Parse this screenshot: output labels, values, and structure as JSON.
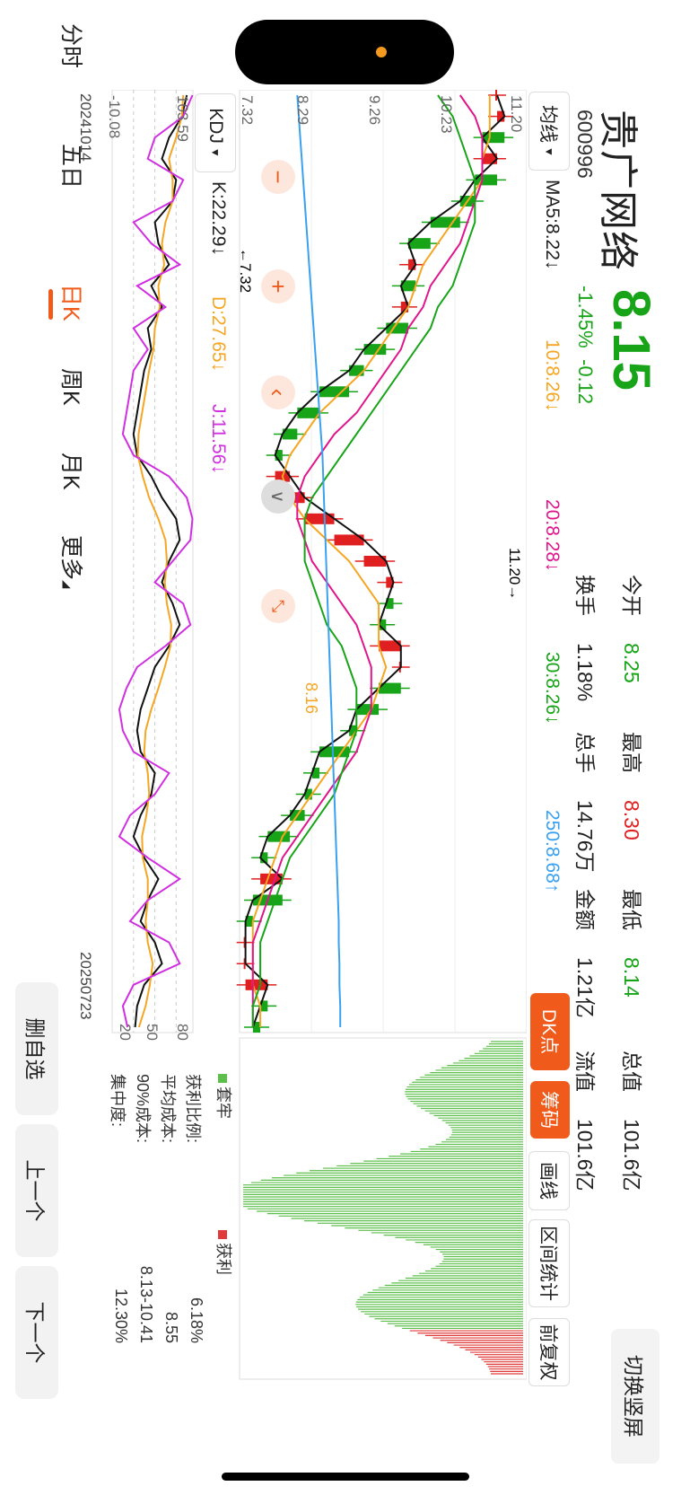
{
  "header": {
    "name": "贵广网络",
    "code": "600996",
    "price": "8.15",
    "change_pct": "-1.45%",
    "change_abs": "-0.12",
    "switch_label": "切换竖屏"
  },
  "stats": [
    {
      "label": "今开",
      "value": "8.25",
      "color": "green"
    },
    {
      "label": "最高",
      "value": "8.30",
      "color": "red"
    },
    {
      "label": "最低",
      "value": "8.14",
      "color": "green"
    },
    {
      "label": "总值",
      "value": "101.6亿",
      "color": "plain"
    },
    {
      "label": "换手",
      "value": "1.18%",
      "color": "plain"
    },
    {
      "label": "总手",
      "value": "14.76万",
      "color": "plain"
    },
    {
      "label": "金额",
      "value": "1.21亿",
      "color": "plain"
    },
    {
      "label": "流值",
      "value": "101.6亿",
      "color": "plain"
    }
  ],
  "toolbar": {
    "ma_button": "均线",
    "ma_values": [
      {
        "text": "MA5:8.22↓",
        "color": "#222222"
      },
      {
        "text": "10:8.26↓",
        "color": "#f5a623"
      },
      {
        "text": "20:8.28↓",
        "color": "#e0158c"
      },
      {
        "text": "30:8.26↓",
        "color": "#18a418"
      },
      {
        "text": "250:8.68↑",
        "color": "#3aa0f0"
      }
    ],
    "dk_button": "DK点",
    "chips_button": "筹码",
    "draw_button": "画线",
    "range_button": "区间统计",
    "adjust_button": "前复权"
  },
  "price_axis": {
    "labels": [
      "11.20",
      "10.23",
      "9.26",
      "8.29",
      "7.32"
    ]
  },
  "annotations": {
    "high_mark": "11.20",
    "low_mark": "7.32",
    "mid_mark": "8.16"
  },
  "kdj": {
    "button": "KDJ",
    "values": [
      {
        "text": "K:22.29↓",
        "color": "#222222"
      },
      {
        "text": "D:27.65↓",
        "color": "#f5a623"
      },
      {
        "text": "J:11.56↓",
        "color": "#d030e0"
      }
    ],
    "axis_top": "103.59",
    "axis_bottom": "-10.08",
    "ref_80": "80",
    "ref_50": "50",
    "ref_20": "20"
  },
  "dates": {
    "start": "20241014",
    "end": "20250723"
  },
  "chips": {
    "legend_trapped": "套牢",
    "legend_profit": "获利",
    "rows": [
      {
        "label": "获利比例:",
        "value": "6.18%"
      },
      {
        "label": "平均成本:",
        "value": "8.55"
      },
      {
        "label": "90%成本:",
        "value": "8.13-10.41"
      },
      {
        "label": "集中度:",
        "value": "12.30%"
      }
    ]
  },
  "tabs": [
    "分时",
    "五日",
    "日K",
    "周K",
    "月K",
    "更多"
  ],
  "active_tab": "日K",
  "actions": {
    "remove": "删自选",
    "prev": "上一个",
    "next": "下一个"
  },
  "colors": {
    "up": "#e02020",
    "down": "#18a418",
    "accent": "#f05a1a",
    "ma250": "#3aa0f0"
  },
  "chart_data": {
    "type": "line",
    "x_range": [
      "20241014",
      "20250723"
    ],
    "ylim": [
      7.32,
      11.2
    ],
    "kdj_ylim": [
      -10.08,
      103.59
    ],
    "series": [
      {
        "name": "MA5",
        "values": [
          10.8,
          10.9,
          10.6,
          10.8,
          10.5,
          10.3,
          9.9,
          9.6,
          9.7,
          9.5,
          9.6,
          9.3,
          9.0,
          8.8,
          8.4,
          8.1,
          7.9,
          7.8,
          8.0,
          8.2,
          8.6,
          9.0,
          9.3,
          9.4,
          9.3,
          9.2,
          9.5,
          9.5,
          9.2,
          8.9,
          8.8,
          8.4,
          8.3,
          8.2,
          8.0,
          7.7,
          7.6,
          7.9,
          7.5,
          7.4,
          7.4,
          7.4,
          7.7,
          7.6,
          7.5
        ]
      },
      {
        "name": "10",
        "values": [
          10.7,
          10.7,
          10.7,
          10.6,
          10.6,
          10.4,
          10.2,
          10.0,
          9.8,
          9.7,
          9.6,
          9.4,
          9.2,
          9.0,
          8.7,
          8.4,
          8.2,
          8.0,
          7.9,
          8.0,
          8.2,
          8.5,
          8.8,
          9.0,
          9.2,
          9.2,
          9.2,
          9.3,
          9.2,
          9.1,
          8.9,
          8.7,
          8.5,
          8.3,
          8.1,
          7.9,
          7.8,
          7.7,
          7.6,
          7.5,
          7.5,
          7.5,
          7.5,
          7.6,
          7.6
        ]
      },
      {
        "name": "20",
        "values": [
          10.3,
          10.5,
          10.6,
          10.6,
          10.6,
          10.5,
          10.4,
          10.3,
          10.1,
          9.9,
          9.8,
          9.6,
          9.5,
          9.3,
          9.1,
          8.9,
          8.6,
          8.4,
          8.2,
          8.1,
          8.1,
          8.2,
          8.3,
          8.5,
          8.7,
          8.9,
          9.0,
          9.1,
          9.1,
          9.1,
          9.0,
          8.9,
          8.7,
          8.5,
          8.3,
          8.1,
          7.9,
          7.8,
          7.7,
          7.6,
          7.5,
          7.5,
          7.5,
          7.5,
          7.5
        ]
      },
      {
        "name": "30",
        "values": [
          10.0,
          10.2,
          10.3,
          10.4,
          10.5,
          10.5,
          10.5,
          10.4,
          10.3,
          10.2,
          10.0,
          9.9,
          9.7,
          9.5,
          9.3,
          9.1,
          8.9,
          8.7,
          8.5,
          8.3,
          8.2,
          8.2,
          8.2,
          8.3,
          8.4,
          8.5,
          8.7,
          8.8,
          8.9,
          8.9,
          8.9,
          8.8,
          8.7,
          8.6,
          8.4,
          8.2,
          8.0,
          7.9,
          7.8,
          7.7,
          7.6,
          7.6,
          7.6,
          7.5,
          7.5
        ]
      },
      {
        "name": "250",
        "values": [
          8.1,
          8.12,
          8.14,
          8.16,
          8.18,
          8.2,
          8.22,
          8.24,
          8.26,
          8.28,
          8.3,
          8.32,
          8.34,
          8.36,
          8.38,
          8.4,
          8.42,
          8.44,
          8.45,
          8.46,
          8.47,
          8.48,
          8.49,
          8.5,
          8.51,
          8.52,
          8.53,
          8.54,
          8.55,
          8.56,
          8.57,
          8.58,
          8.59,
          8.6,
          8.61,
          8.62,
          8.63,
          8.64,
          8.65,
          8.66,
          8.66,
          8.67,
          8.67,
          8.68,
          8.68
        ]
      }
    ],
    "kdj_series": [
      {
        "name": "K",
        "values": [
          95,
          88,
          70,
          60,
          80,
          75,
          50,
          55,
          70,
          45,
          60,
          40,
          45,
          35,
          30,
          25,
          20,
          25,
          45,
          60,
          80,
          85,
          70,
          60,
          75,
          85,
          70,
          50,
          40,
          30,
          25,
          30,
          50,
          45,
          30,
          20,
          35,
          55,
          40,
          30,
          50,
          60,
          35,
          25,
          22.29
        ]
      },
      {
        "name": "D",
        "values": [
          90,
          88,
          80,
          70,
          75,
          75,
          65,
          60,
          63,
          55,
          57,
          50,
          48,
          42,
          37,
          32,
          27,
          26,
          33,
          42,
          55,
          65,
          67,
          64,
          67,
          73,
          72,
          64,
          55,
          45,
          37,
          35,
          40,
          42,
          38,
          32,
          33,
          40,
          40,
          37,
          40,
          47,
          43,
          37,
          27.65
        ]
      },
      {
        "name": "J",
        "values": [
          103,
          90,
          50,
          40,
          90,
          75,
          20,
          45,
          85,
          25,
          65,
          20,
          40,
          20,
          15,
          10,
          5,
          20,
          70,
          95,
          103,
          100,
          75,
          50,
          90,
          100,
          65,
          25,
          10,
          0,
          5,
          20,
          70,
          50,
          15,
          0,
          40,
          85,
          40,
          15,
          70,
          85,
          20,
          5,
          11.56
        ]
      }
    ]
  }
}
